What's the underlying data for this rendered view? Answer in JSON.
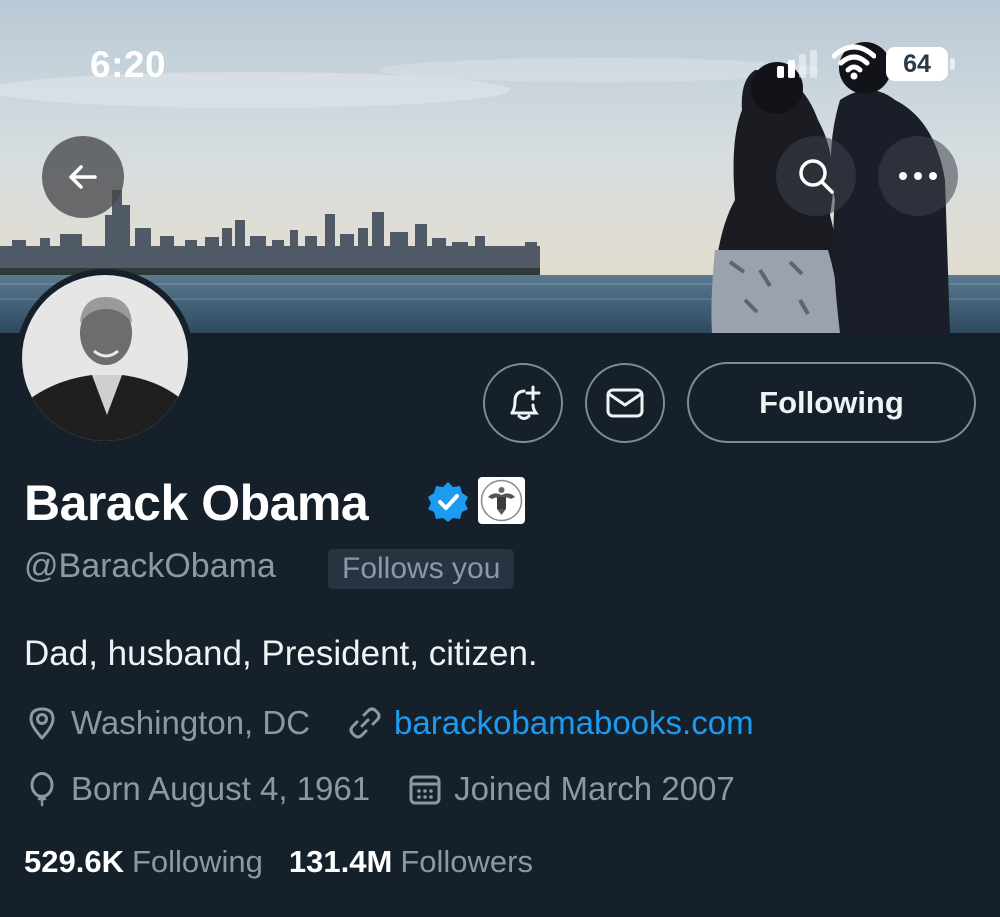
{
  "status_bar": {
    "time": "6:20",
    "battery": "64"
  },
  "icons": {
    "back": "arrow-left-icon",
    "search": "search-icon",
    "more": "more-horizontal-icon",
    "notify": "bell-plus-icon",
    "message": "envelope-icon",
    "verified": "verified-badge-icon",
    "affiliation": "us-seal-icon",
    "location": "location-pin-icon",
    "link": "link-icon",
    "birthday": "balloon-icon",
    "joined": "calendar-icon"
  },
  "profile": {
    "display_name": "Barack Obama",
    "handle": "@BarackObama",
    "follows_you": "Follows you",
    "bio": "Dad, husband, President, citizen.",
    "location": "Washington, DC",
    "website": "barackobamabooks.com",
    "born": "Born August 4, 1961",
    "joined": "Joined March 2007"
  },
  "actions": {
    "following_label": "Following"
  },
  "stats": {
    "following_count": "529.6K",
    "following_label": "Following",
    "followers_count": "131.4M",
    "followers_label": "Followers"
  },
  "colors": {
    "background": "#15202b",
    "accent": "#1d9bf0",
    "muted_text": "#8b98a5",
    "verified": "#1d9bf0"
  }
}
